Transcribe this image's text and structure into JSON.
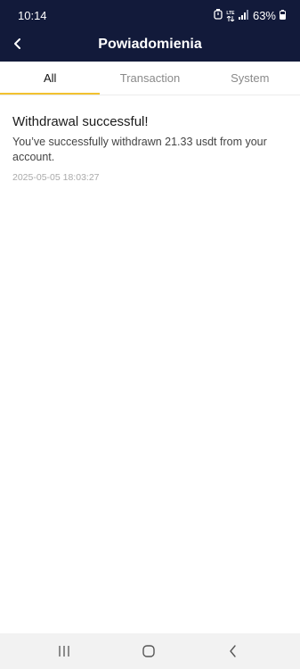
{
  "status_bar": {
    "time": "10:14",
    "network": "LTE",
    "battery": "63%"
  },
  "header": {
    "title": "Powiadomienia",
    "back_icon": "chevron-left-icon"
  },
  "tabs": [
    {
      "label": "All",
      "active": true
    },
    {
      "label": "Transaction",
      "active": false
    },
    {
      "label": "System",
      "active": false
    }
  ],
  "notifications": [
    {
      "title": "Withdrawal successful!",
      "body": "You’ve successfully withdrawn 21.33 usdt from your account.",
      "time": "2025-05-05 18:03:27"
    }
  ],
  "nav": {
    "icons": [
      "recent-apps-icon",
      "home-icon",
      "back-icon"
    ]
  },
  "colors": {
    "header_bg": "#121a3a",
    "tab_indicator": "#f2c230",
    "nav_bg": "#f2f2f2"
  }
}
